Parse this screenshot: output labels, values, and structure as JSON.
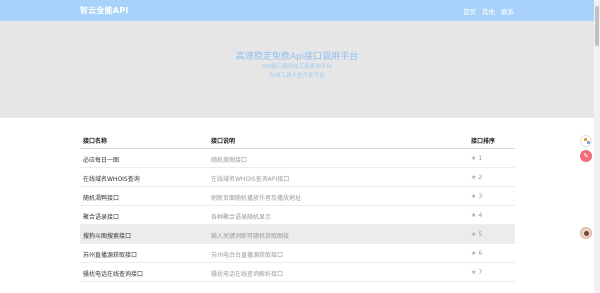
{
  "header": {
    "brand": "智云全能API",
    "nav": [
      "首页",
      "其他",
      "联系"
    ]
  },
  "hero": {
    "title": "高速稳定免费Api接口调用平台",
    "subtitle1": "API接口调用在工具查询平台",
    "subtitle2": "在线工具大全开发平台"
  },
  "table": {
    "headers": [
      "接口名称",
      "接口说明",
      "接口排序"
    ],
    "rows": [
      {
        "name": "必应每日一图",
        "desc": "随机美图接口",
        "rank": "1"
      },
      {
        "name": "在线域名WHOIS查询",
        "desc": "在线域名WHOIS查询API接口",
        "rank": "2"
      },
      {
        "name": "随机渴鸭接口",
        "desc": "刷新页面随机播放作者及播放地址",
        "rank": "3"
      },
      {
        "name": "聚合语录接口",
        "desc": "各种聚合语录随机显示",
        "rank": "4"
      },
      {
        "name": "搜狗斗图搜索接口",
        "desc": "输入关键词即可随机获取图接",
        "rank": "5"
      },
      {
        "name": "苏州直播源获取接口",
        "desc": "苏州电台台直播源获取接口",
        "rank": "6"
      },
      {
        "name": "骚扰电话在线查询接口",
        "desc": "骚扰电话在线查询解析接口",
        "rank": "7"
      }
    ]
  },
  "icons": {
    "star": "star-icon",
    "float1": "chart-icon",
    "float2": "sign-icon",
    "float3": "avatar-icon"
  },
  "colors": {
    "topbar": "#a9d2fa",
    "hero_bg": "#e6e6e6",
    "hero_text": "#8ec0f2"
  }
}
